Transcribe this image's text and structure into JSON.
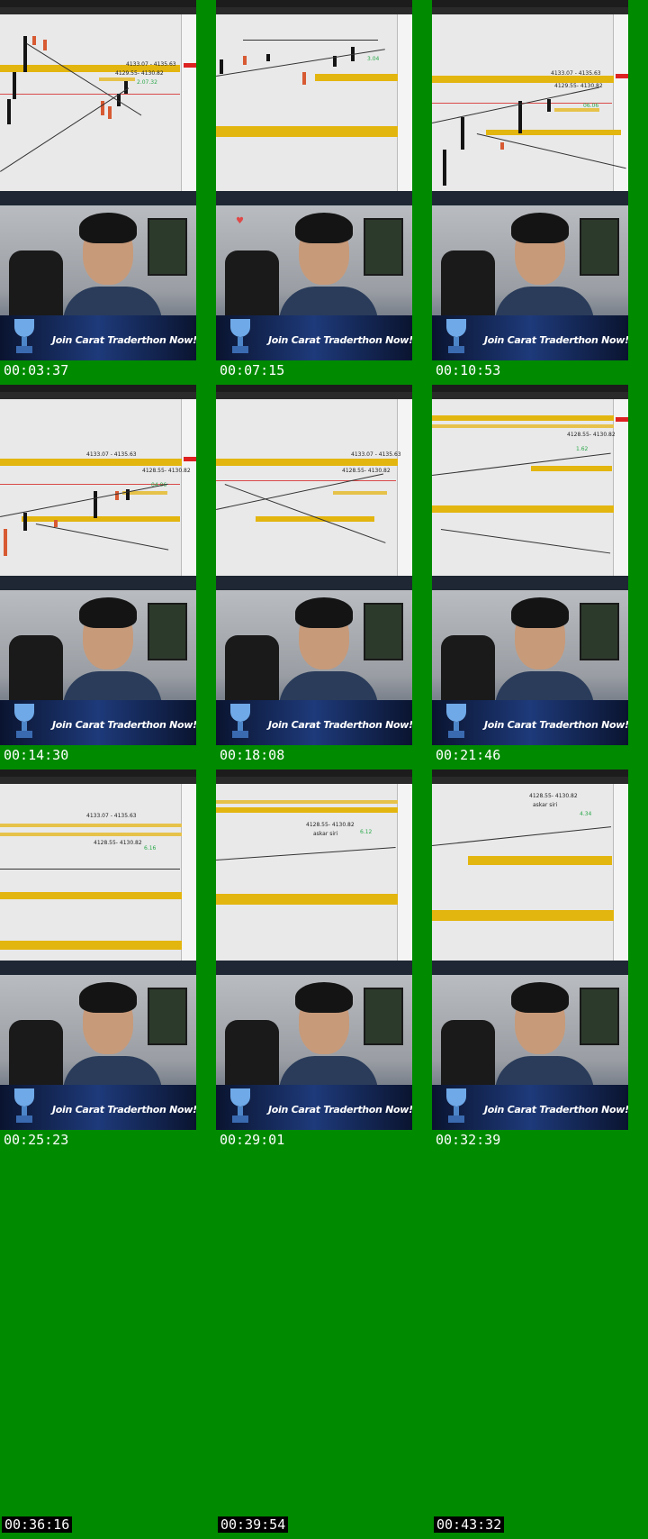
{
  "overlay": {
    "banner_text": "Join Carat Traderthon Now!"
  },
  "frames": [
    {
      "timestamp": "00:03:37",
      "kind": "chart",
      "labels": {
        "zone_a": "4133.07 - 4135.63",
        "zone_b": "4129.55- 4130.82",
        "green": "2.07.32"
      }
    },
    {
      "timestamp": "00:07:15",
      "kind": "chart",
      "labels": {
        "green": "3.04"
      }
    },
    {
      "timestamp": "00:10:53",
      "kind": "chart",
      "labels": {
        "zone_a": "4133.07 - 4135.63",
        "zone_b": "4129.55- 4130.82",
        "green": "06.06"
      }
    },
    {
      "timestamp": "00:14:30",
      "kind": "chart",
      "labels": {
        "zone_a": "4133.07 - 4135.63",
        "zone_b": "4128.55- 4130.82",
        "green": "04.06"
      }
    },
    {
      "timestamp": "00:18:08",
      "kind": "chart",
      "labels": {
        "zone_a": "4133.07 - 4135.63",
        "zone_b": "4128.55- 4130.82",
        "green": ""
      }
    },
    {
      "timestamp": "00:21:46",
      "kind": "chart",
      "labels": {
        "zone_b": "4128.55- 4130.82",
        "green": "1.62"
      }
    },
    {
      "timestamp": "00:25:23",
      "kind": "chart",
      "labels": {
        "zone_a": "4133.07 - 4135.63",
        "zone_b": "4128.55- 4130.82",
        "green": "6.16"
      }
    },
    {
      "timestamp": "00:29:01",
      "kind": "chart",
      "labels": {
        "zone_b": "4128.55- 4130.82",
        "note": "askar siri",
        "green": "6.12"
      }
    },
    {
      "timestamp": "00:32:39",
      "kind": "chart",
      "labels": {
        "zone_b": "4128.55- 4130.82",
        "note": "askar siri",
        "green": "4.34"
      }
    },
    {
      "timestamp": "00:36:16",
      "kind": "empty"
    },
    {
      "timestamp": "00:39:54",
      "kind": "empty"
    },
    {
      "timestamp": "00:43:32",
      "kind": "empty"
    }
  ]
}
